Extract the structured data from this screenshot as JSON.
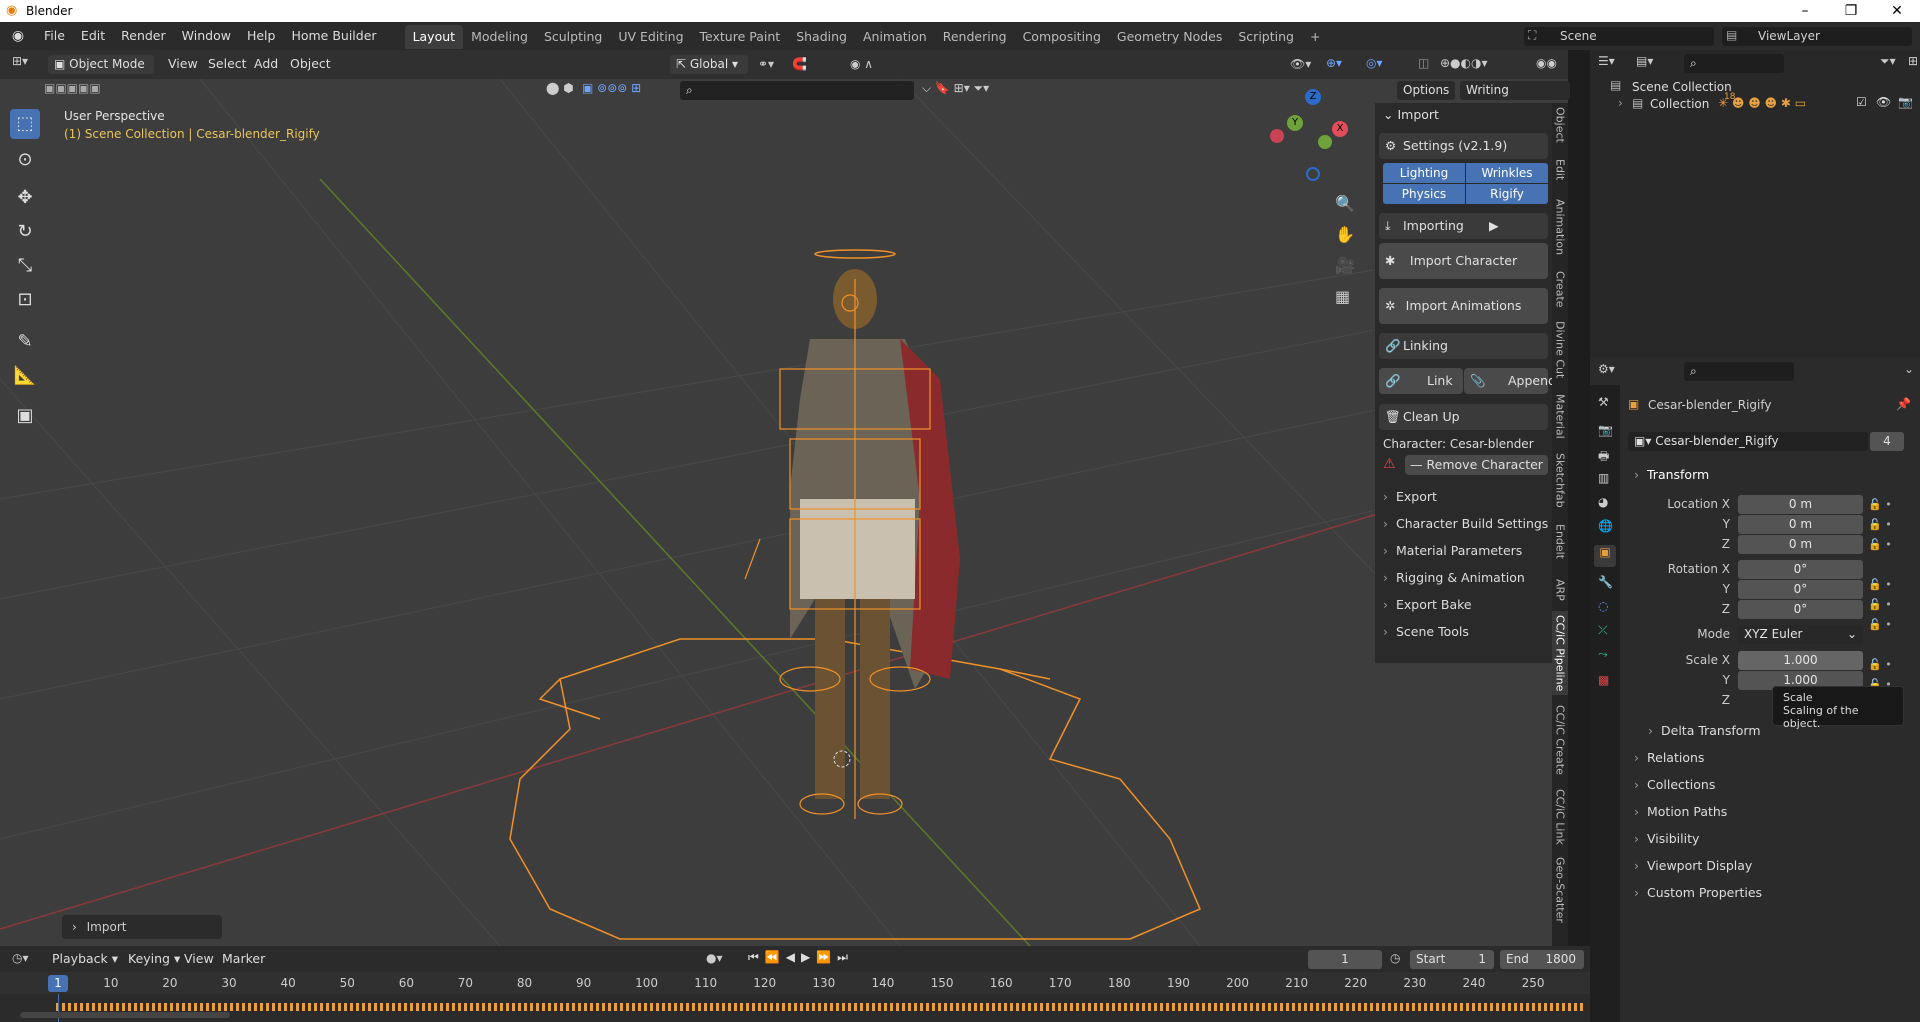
{
  "window": {
    "title": "Blender"
  },
  "menus": [
    "File",
    "Edit",
    "Render",
    "Window",
    "Help",
    "Home Builder"
  ],
  "workspaces": [
    "Layout",
    "Modeling",
    "Sculpting",
    "UV Editing",
    "Texture Paint",
    "Shading",
    "Animation",
    "Rendering",
    "Compositing",
    "Geometry Nodes",
    "Scripting",
    "+"
  ],
  "scene": {
    "name": "Scene",
    "view_layer": "ViewLayer"
  },
  "viewport": {
    "mode": "Object Mode",
    "menus": [
      "View",
      "Select",
      "Add",
      "Object"
    ],
    "orientation": "Global",
    "options_label": "Options",
    "writing_label": "Writing Animation",
    "perspective": "User Perspective",
    "collection_info": "(1) Scene Collection | Cesar-blender_Rigify",
    "last_op": "Import",
    "gizmo": {
      "z": "Z",
      "y": "Y",
      "x": "X"
    }
  },
  "npanel": {
    "header": "Import",
    "settings": "Settings  (v2.1.9)",
    "toggles": [
      "Lighting",
      "Wrinkles",
      "Physics",
      "Rigify"
    ],
    "importing": "Importing",
    "import_character": "Import Character",
    "import_animations": "Import Animations",
    "linking": "Linking",
    "link": "Link",
    "append": "Append",
    "cleanup": "Clean Up",
    "character": "Character: Cesar-blender",
    "remove": "Remove Character",
    "sections": [
      "Export",
      "Character Build Settings",
      "Material Parameters",
      "Rigging & Animation",
      "Export Bake",
      "Scene Tools"
    ],
    "tabs": [
      "Object",
      "Edit",
      "Animation",
      "Create",
      "Divine Cut",
      "Material",
      "Sketchfab",
      "Endelt",
      "ARP",
      "CC/iC Pipeline",
      "CC/iC Create",
      "CC/iC Link",
      "Geo-Scatter"
    ]
  },
  "outliner": {
    "root": "Scene Collection",
    "collection": "Collection",
    "count": "18"
  },
  "properties": {
    "object_name": "Cesar-blender_Rigify",
    "data_name": "Cesar-blender_Rigify",
    "users": "4",
    "transform": "Transform",
    "location_label": "Location X",
    "rotation_label": "Rotation X",
    "scale_label": "Scale X",
    "y": "Y",
    "z": "Z",
    "location": [
      "0 m",
      "0 m",
      "0 m"
    ],
    "rotation": [
      "0°",
      "0°",
      "0°"
    ],
    "mode_label": "Mode",
    "mode": "XYZ Euler",
    "scale": [
      "1.000",
      "1.000"
    ],
    "tooltip_title": "Scale",
    "tooltip_body": "Scaling of the object.",
    "delta": "Delta Transform",
    "sections": [
      "Relations",
      "Collections",
      "Motion Paths",
      "Visibility",
      "Viewport Display",
      "Custom Properties"
    ]
  },
  "timeline": {
    "menus": [
      "Playback",
      "Keying",
      "View",
      "Marker"
    ],
    "current_frame": "1",
    "start_label": "Start",
    "start": "1",
    "end_label": "End",
    "end": "1800",
    "ticks": [
      "1",
      "10",
      "20",
      "30",
      "40",
      "50",
      "60",
      "70",
      "80",
      "90",
      "100",
      "110",
      "120",
      "130",
      "140",
      "150",
      "160",
      "170",
      "180",
      "190",
      "200",
      "210",
      "220",
      "230",
      "240",
      "250"
    ]
  }
}
